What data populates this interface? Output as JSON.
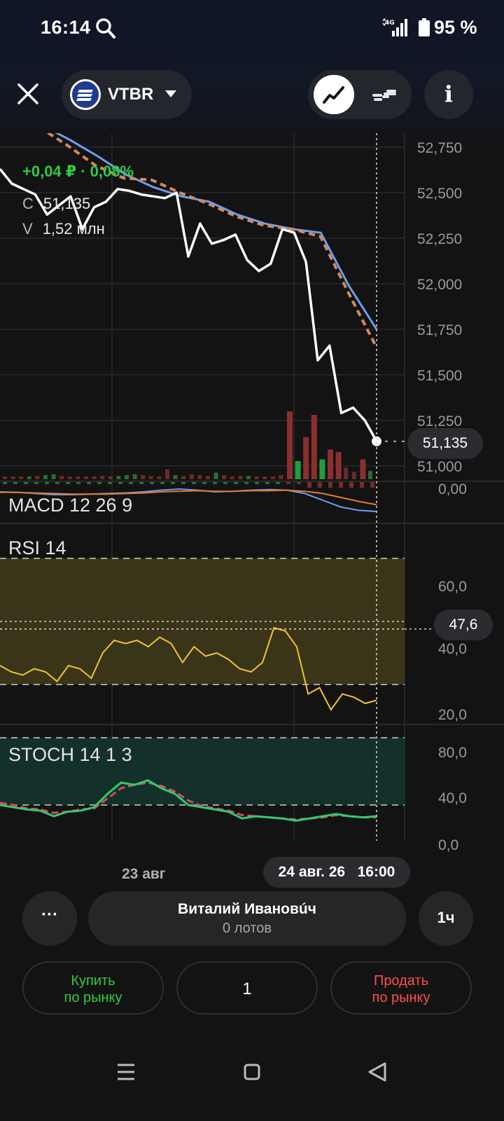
{
  "status_bar": {
    "time": "16:14",
    "network": "4G",
    "battery": "95 %"
  },
  "header": {
    "ticker": "VTBR",
    "chart_modes": [
      "line-chart-icon",
      "candles-icon"
    ],
    "info_label": "i"
  },
  "quote": {
    "change": "+0,04 ₽ · 0,08%",
    "close_key": "C",
    "close_value": "51,135",
    "volume_key": "V",
    "volume_value": "1,52 млн"
  },
  "chart_data": [
    {
      "type": "line",
      "title": "",
      "y_ticks": [
        "52,750",
        "52,500",
        "52,250",
        "52,000",
        "51,750",
        "51,500",
        "51,250",
        "51,000"
      ],
      "ylim": [
        51.0,
        52.75
      ],
      "current_price_label": "51,135",
      "x_labels": [
        "23 авг",
        "24 авг. 26",
        "16:00"
      ],
      "series": [
        {
          "values": [
            52.63,
            52.55,
            52.52,
            52.49,
            52.38,
            52.43,
            52.48,
            52.3,
            52.42,
            52.45,
            52.52,
            52.51,
            52.49,
            52.48,
            52.47,
            52.5,
            52.15,
            52.33,
            52.22,
            52.24,
            52.27,
            52.13,
            52.07,
            52.11,
            52.3,
            52.28,
            52.12,
            51.58,
            51.66,
            51.29,
            51.32,
            51.25,
            51.135
          ]
        },
        {
          "values": [
            52.87,
            52.79,
            52.7,
            52.6,
            52.53,
            52.48,
            52.45,
            52.38,
            52.33,
            52.3,
            52.28,
            51.99,
            51.75
          ]
        },
        {
          "values": [
            52.86,
            52.76,
            52.65,
            52.58,
            52.57,
            52.5,
            52.44,
            52.37,
            52.32,
            52.3,
            52.26,
            51.95,
            51.65
          ]
        }
      ],
      "grid": true
    },
    {
      "type": "bar",
      "title": "",
      "values": [
        0.02,
        0.03,
        0.02,
        0.03,
        0.04,
        0.05,
        0.06,
        0.04,
        0.03,
        0.02,
        0.02,
        0.02,
        0.04,
        0.03,
        0.04,
        0.05,
        0.06,
        0.05,
        0.04,
        0.03,
        0.12,
        0.05,
        0.04,
        0.06,
        0.05,
        0.04,
        0.08,
        0.05,
        0.03,
        0.04,
        0.04,
        0.03,
        0.02,
        0.03,
        0.05,
        0.82,
        0.22,
        0.51,
        0.78,
        0.24,
        0.36,
        0.33,
        0.14,
        0.09,
        0.24,
        0.1
      ]
    },
    {
      "type": "line",
      "title": "MACD 12 26 9",
      "y_ticks": [
        "0,00"
      ],
      "series": [
        {
          "values": [
            0.05,
            0.04,
            0.02,
            0.0,
            0.0,
            0.01,
            0.02,
            0.03,
            0.05,
            0.08,
            0.1,
            0.08,
            0.05,
            0.06,
            0.08,
            0.09,
            0.08,
            0.02,
            -0.1,
            -0.22,
            -0.28,
            -0.3
          ]
        },
        {
          "values": [
            0.04,
            0.04,
            0.03,
            0.02,
            0.01,
            0.01,
            0.01,
            0.02,
            0.03,
            0.05,
            0.06,
            0.07,
            0.06,
            0.06,
            0.07,
            0.07,
            0.08,
            0.06,
            0.02,
            -0.05,
            -0.12,
            -0.18
          ]
        }
      ]
    },
    {
      "type": "line",
      "title": "RSI 14",
      "y_ticks": [
        "60,0",
        "40,0",
        "20,0"
      ],
      "current_value_label": "47,6",
      "levels": [
        70,
        50,
        30
      ],
      "series": [
        {
          "values": [
            36,
            34,
            33,
            35,
            34,
            31,
            36,
            35,
            32,
            40,
            44,
            43,
            44,
            42,
            45,
            43,
            37,
            42,
            39,
            40,
            38,
            35,
            34,
            37,
            48,
            47,
            42,
            27,
            29,
            22,
            27,
            26,
            24,
            25
          ]
        }
      ]
    },
    {
      "type": "line",
      "title": "STOCH 14 1 3",
      "y_ticks": [
        "80,0",
        "40,0",
        "0,0"
      ],
      "levels": [
        80,
        20
      ],
      "series": [
        {
          "values": [
            20,
            18,
            16,
            15,
            10,
            14,
            15,
            18,
            30,
            40,
            38,
            42,
            35,
            30,
            20,
            18,
            16,
            14,
            8,
            10,
            9,
            8,
            6,
            8,
            10,
            12,
            10,
            9,
            10
          ]
        },
        {
          "values": [
            22,
            20,
            17,
            16,
            13,
            14,
            16,
            17,
            26,
            35,
            38,
            40,
            37,
            32,
            24,
            19,
            17,
            15,
            11,
            10,
            9,
            8,
            7,
            8,
            9,
            11,
            10,
            9,
            9
          ]
        }
      ]
    }
  ],
  "controls": {
    "more_label": "···",
    "account_name": "Виталий Ивановúч",
    "lots": "0 лотов",
    "timeframe": "1ч",
    "buy_line1": "Купить",
    "buy_line2": "по рынку",
    "quantity": "1",
    "sell_line1": "Продать",
    "sell_line2": "по рынку"
  },
  "colors": {
    "price_line": "#ffffff",
    "ma_blue": "#6e9df0",
    "ma_orange": "#d4895a",
    "buy": "#2ecc40",
    "sell": "#ff4d4d",
    "rsi_zone": "#3a3518",
    "stoch_zone": "#14302a",
    "rsi_line": "#f1c232"
  }
}
